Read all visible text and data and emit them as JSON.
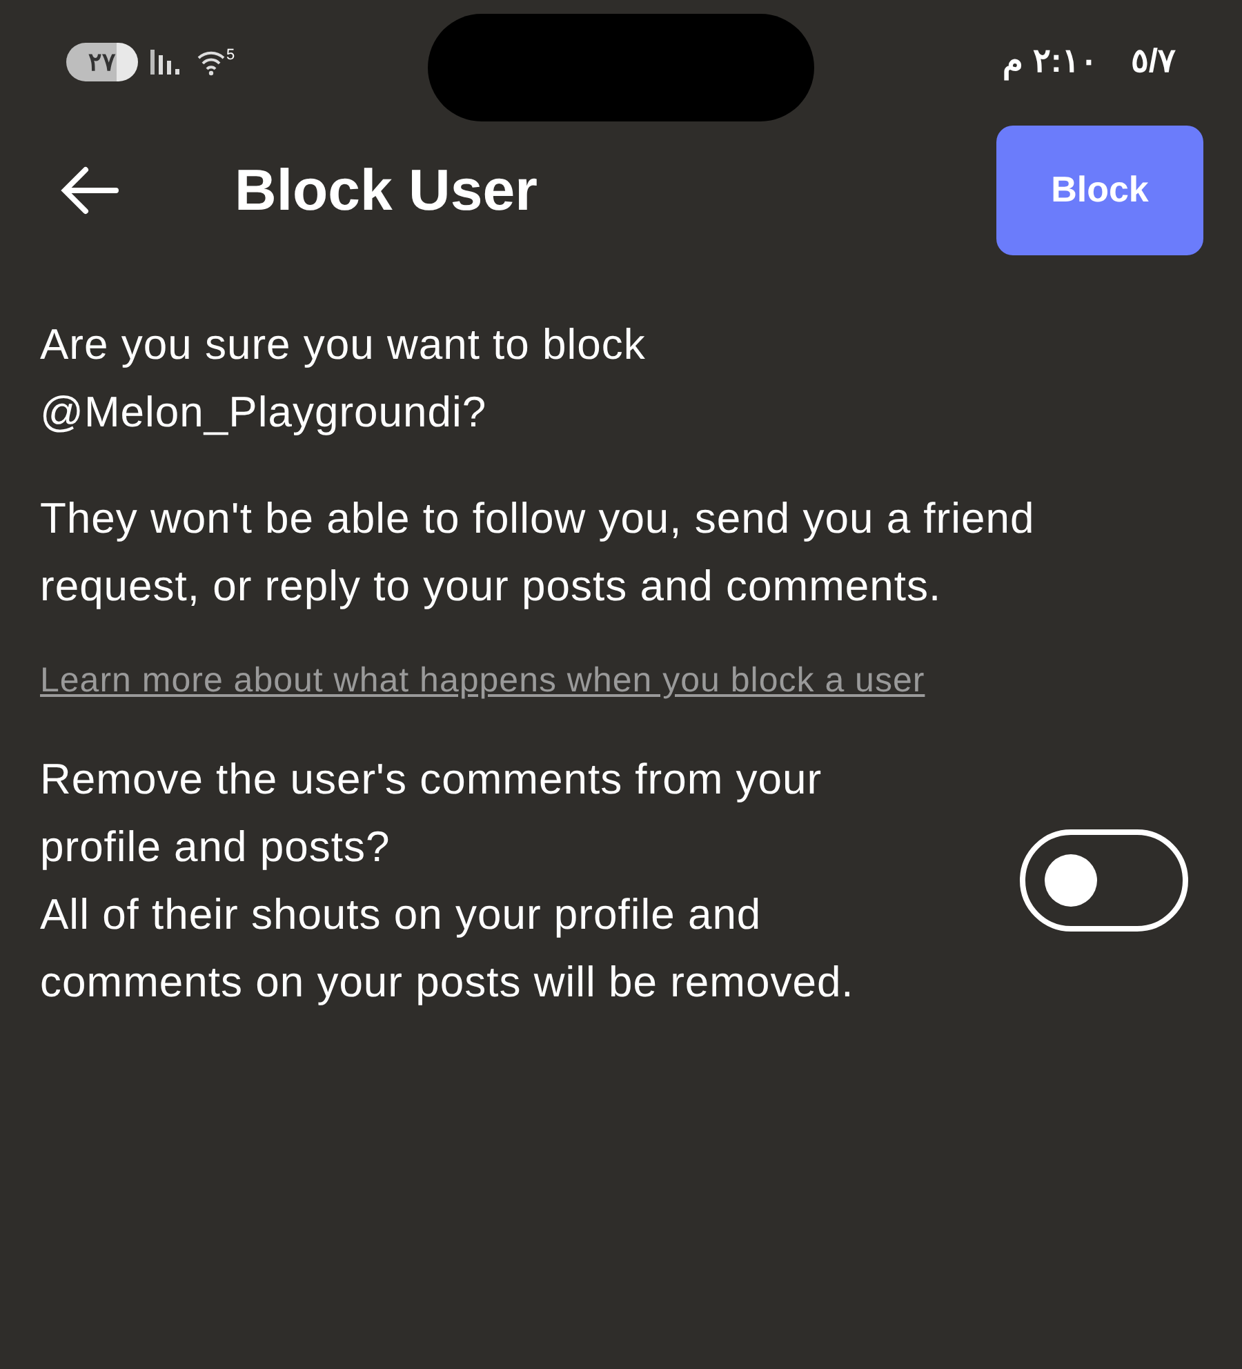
{
  "status_bar": {
    "battery": "٢٧",
    "date": "٥/٧",
    "time": "٢:١٠ م",
    "wifi_badge": "5"
  },
  "header": {
    "title": "Block User",
    "action": "Block"
  },
  "question": "Are you sure you want to block @Melon_Playgroundi?",
  "explanation": "They won't be able to follow you, send you a friend request, or reply to your posts and comments.",
  "learn_more_link": "Learn more about what happens when you block a user",
  "option": {
    "title": "Remove the user's comments from your profile and posts?",
    "description": "All of their shouts on your profile and comments on your posts will be removed.",
    "on": false
  }
}
